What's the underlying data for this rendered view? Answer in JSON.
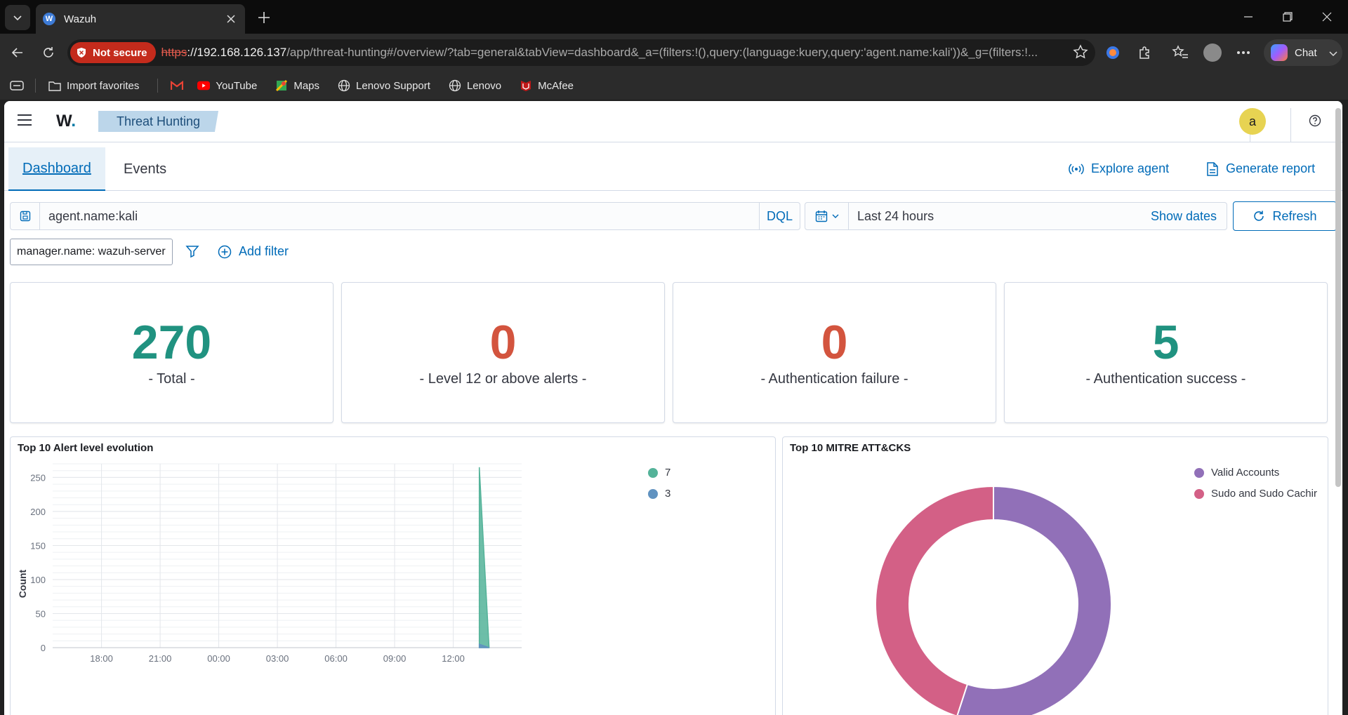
{
  "browser": {
    "tab_title": "Wazuh",
    "tab_favicon": "W",
    "not_secure_label": "Not secure",
    "url_proto": "https",
    "url_host": "://192.168.126.137",
    "url_path": "/app/threat-hunting#/overview/?tab=general&tabView=dashboard&_a=(filters:!(),query:(language:kuery,query:'agent.name:kali'))&_g=(filters:!...",
    "chat_label": "Chat",
    "bookmarks": [
      "Import favorites",
      "YouTube",
      "Maps",
      "Lenovo Support",
      "Lenovo",
      "McAfee"
    ]
  },
  "header": {
    "logo": "W",
    "logo_dot": ".",
    "breadcrumb": "Threat Hunting",
    "user_initial": "a"
  },
  "tabs": {
    "dashboard": "Dashboard",
    "events": "Events",
    "explore_agent": "Explore agent",
    "generate_report": "Generate report"
  },
  "query": {
    "text": "agent.name:kali",
    "language": "DQL",
    "time_range": "Last 24 hours",
    "show_dates": "Show dates",
    "refresh": "Refresh"
  },
  "filters": {
    "pill": "manager.name: wazuh-server",
    "add_filter": "Add filter"
  },
  "stats": [
    {
      "value": "270",
      "label": "- Total -",
      "color": "#209280"
    },
    {
      "value": "0",
      "label": "- Level 12 or above alerts -",
      "color": "#d3543e"
    },
    {
      "value": "0",
      "label": "- Authentication failure -",
      "color": "#d3543e"
    },
    {
      "value": "5",
      "label": "- Authentication success -",
      "color": "#209280"
    }
  ],
  "chart_data": [
    {
      "type": "area",
      "title": "Top 10 Alert level evolution",
      "ylabel": "Count",
      "xlabel": "",
      "ylim": [
        0,
        270
      ],
      "yticks": [
        0,
        50,
        100,
        150,
        200,
        250
      ],
      "xticks": [
        "18:00",
        "21:00",
        "00:00",
        "03:00",
        "06:00",
        "09:00",
        "12:00"
      ],
      "legend_position": "top-right",
      "series": [
        {
          "name": "7",
          "color": "#54b399",
          "x": [
            "13:20",
            "13:50"
          ],
          "values": [
            265,
            0
          ]
        },
        {
          "name": "3",
          "color": "#6092c0",
          "x": [
            "13:20",
            "13:50"
          ],
          "values": [
            5,
            0
          ]
        }
      ]
    },
    {
      "type": "pie",
      "title": "Top 10 MITRE ATT&CKS",
      "legend_position": "top-right",
      "categories": [
        "Valid Accounts",
        "Sudo and Sudo Cachir"
      ],
      "values": [
        55,
        45
      ],
      "colors": [
        "#9170b8",
        "#d36086"
      ]
    }
  ]
}
